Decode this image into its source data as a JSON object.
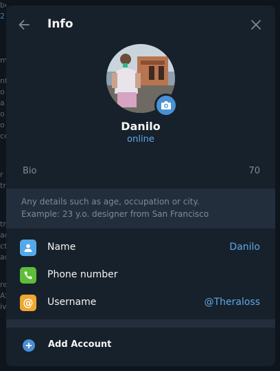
{
  "background": {
    "fragments": [
      "bers",
      "2",
      "m",
      "nt",
      "o",
      "a",
      "o",
      "o",
      "ce",
      "r",
      "tr",
      "tr",
      "ac",
      "cta",
      "ac",
      "re",
      "AS",
      "iv"
    ]
  },
  "header": {
    "title": "Info",
    "back_icon": "arrow-left-icon",
    "close_icon": "close-icon"
  },
  "profile": {
    "name": "Danilo",
    "status": "online",
    "camera_icon": "camera-icon"
  },
  "bio": {
    "label": "Bio",
    "remaining": "70",
    "hint_line1": "Any details such as age, occupation or city.",
    "hint_line2": "Example: 23 y.o. designer from San Francisco"
  },
  "fields": [
    {
      "label": "Name",
      "value": "Danilo",
      "icon": "user-icon",
      "color": "#54a9eb"
    },
    {
      "label": "Phone number",
      "value": "",
      "icon": "phone-icon",
      "color": "#5fbd3a"
    },
    {
      "label": "Username",
      "value": "@Theraloss",
      "icon": "at-icon",
      "color": "#f0a732"
    }
  ],
  "footer": {
    "add_account": "Add Account",
    "add_icon": "plus-circle-icon"
  },
  "colors": {
    "accent": "#5fa8e8",
    "modal_bg": "#17212b",
    "hint_bg": "#232e3c"
  }
}
